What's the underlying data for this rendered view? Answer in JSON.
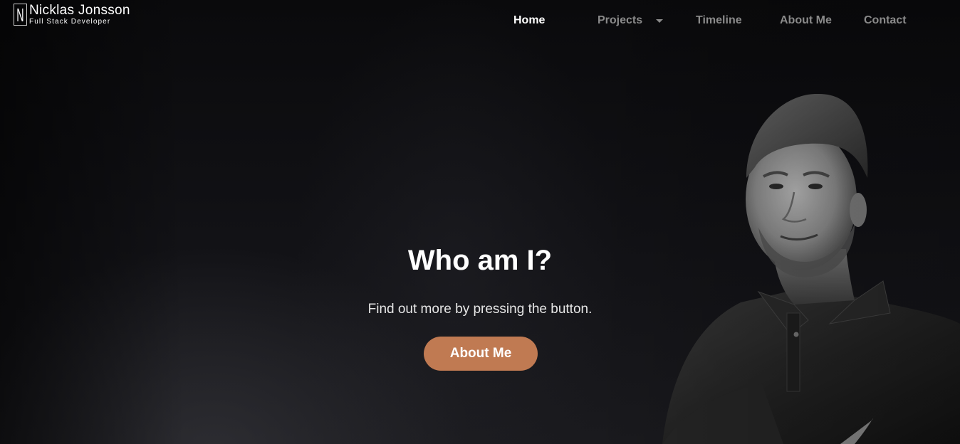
{
  "logo": {
    "mark": "N",
    "name": "Nicklas Jonsson",
    "subtitle": "Full Stack Developer"
  },
  "nav": {
    "items": [
      {
        "label": "Home",
        "active": true
      },
      {
        "label": "Projects",
        "has_dropdown": true
      },
      {
        "label": "Timeline"
      },
      {
        "label": "About Me"
      },
      {
        "label": "Contact"
      }
    ]
  },
  "hero": {
    "title": "Who am I?",
    "subtitle": "Find out more by pressing the button.",
    "button_label": "About Me"
  },
  "colors": {
    "accent": "#c07a52",
    "background": "#0c0c0e",
    "nav_active": "#ffffff",
    "nav_inactive": "#8a8a8a"
  },
  "icons": {
    "projects_dropdown": "caret-down-icon"
  }
}
